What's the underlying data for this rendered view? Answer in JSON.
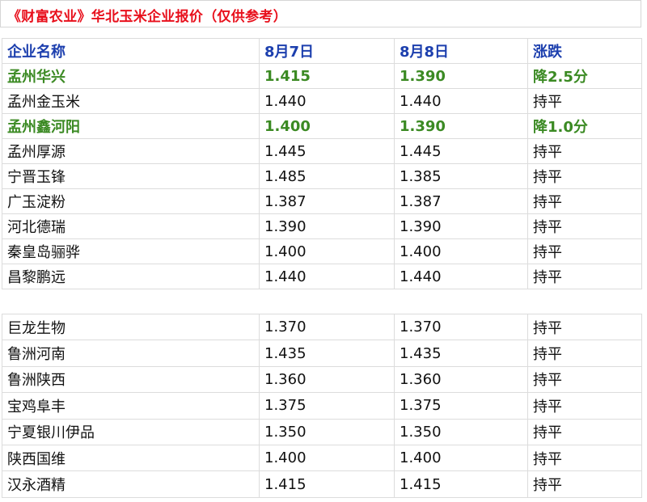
{
  "title": "《财富农业》华北玉米企业报价（仅供参考）",
  "colors": {
    "title": "#e8101c",
    "header": "#1c3fae",
    "highlight": "#3b8a23"
  },
  "columns": [
    "企业名称",
    "8月7日",
    "8月8日",
    "涨跌"
  ],
  "group_a": [
    {
      "name": "孟州华兴",
      "aug7": "1.415",
      "aug8": "1.390",
      "change": "降2.5分",
      "highlight": true
    },
    {
      "name": "孟州金玉米",
      "aug7": "1.440",
      "aug8": "1.440",
      "change": "持平",
      "highlight": false
    },
    {
      "name": "孟州鑫河阳",
      "aug7": "1.400",
      "aug8": "1.390",
      "change": "降1.0分",
      "highlight": true
    },
    {
      "name": "孟州厚源",
      "aug7": "1.445",
      "aug8": "1.445",
      "change": "持平",
      "highlight": false
    },
    {
      "name": "宁晋玉锋",
      "aug7": "1.485",
      "aug8": "1.385",
      "change": "持平",
      "highlight": false
    },
    {
      "name": "广玉淀粉",
      "aug7": "1.387",
      "aug8": "1.387",
      "change": "持平",
      "highlight": false
    },
    {
      "name": "河北德瑞",
      "aug7": "1.390",
      "aug8": "1.390",
      "change": "持平",
      "highlight": false
    },
    {
      "name": "秦皇岛骊骅",
      "aug7": "1.400",
      "aug8": "1.400",
      "change": "持平",
      "highlight": false
    },
    {
      "name": "昌黎鹏远",
      "aug7": "1.440",
      "aug8": "1.440",
      "change": "持平",
      "highlight": false
    }
  ],
  "group_b": [
    {
      "name": "巨龙生物",
      "aug7": "1.370",
      "aug8": "1.370",
      "change": "持平"
    },
    {
      "name": "鲁洲河南",
      "aug7": "1.435",
      "aug8": "1.435",
      "change": "持平"
    },
    {
      "name": "鲁洲陕西",
      "aug7": "1.360",
      "aug8": "1.360",
      "change": "持平"
    },
    {
      "name": "宝鸡阜丰",
      "aug7": "1.375",
      "aug8": "1.375",
      "change": "持平"
    },
    {
      "name": "宁夏银川伊品",
      "aug7": "1.350",
      "aug8": "1.350",
      "change": "持平"
    },
    {
      "name": "陕西国维",
      "aug7": "1.400",
      "aug8": "1.400",
      "change": "持平"
    },
    {
      "name": "汉永酒精",
      "aug7": "1.415",
      "aug8": "1.415",
      "change": "持平"
    }
  ]
}
